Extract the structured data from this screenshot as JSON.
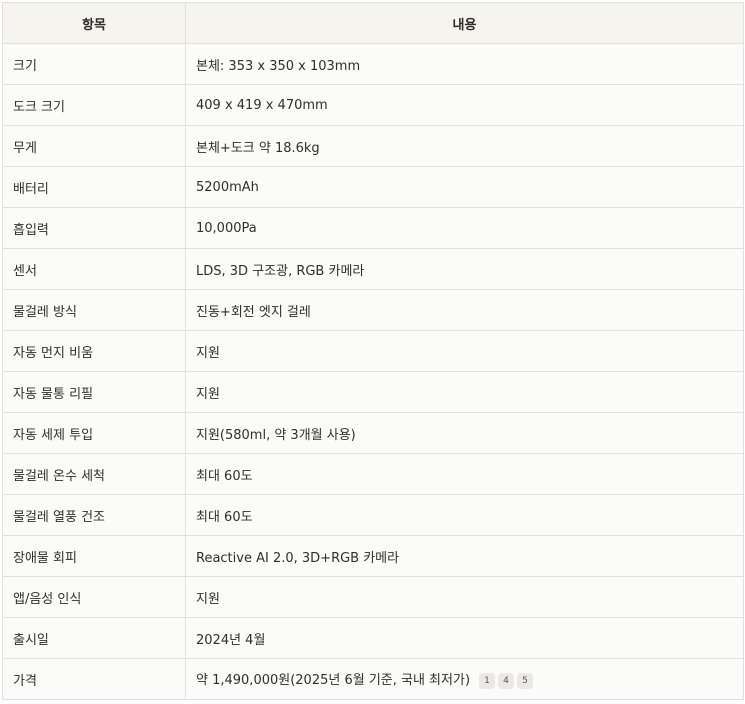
{
  "table": {
    "headers": [
      "항목",
      "내용"
    ],
    "rows": [
      {
        "label": "크기",
        "value": "본체: 353 x 350 x 103mm"
      },
      {
        "label": "도크 크기",
        "value": "409 x 419 x 470mm"
      },
      {
        "label": "무게",
        "value": "본체+도크 약 18.6kg"
      },
      {
        "label": "배터리",
        "value": "5200mAh"
      },
      {
        "label": "흡입력",
        "value": "10,000Pa"
      },
      {
        "label": "센서",
        "value": "LDS, 3D 구조광, RGB 카메라"
      },
      {
        "label": "물걸레 방식",
        "value": "진동+회전 엣지 걸레"
      },
      {
        "label": "자동 먼지 비움",
        "value": "지원"
      },
      {
        "label": "자동 물통 리필",
        "value": "지원"
      },
      {
        "label": "자동 세제 투입",
        "value": "지원(580ml, 약 3개월 사용)"
      },
      {
        "label": "물걸레 온수 세척",
        "value": "최대 60도"
      },
      {
        "label": "물걸레 열풍 건조",
        "value": "최대 60도"
      },
      {
        "label": "장애물 회피",
        "value": "Reactive AI 2.0, 3D+RGB 카메라"
      },
      {
        "label": "앱/음성 인식",
        "value": "지원"
      },
      {
        "label": "출시일",
        "value": "2024년 4월"
      },
      {
        "label": "가격",
        "value": "약 1,490,000원(2025년 6월 기준, 국내 최저가)",
        "citations": [
          "1",
          "4",
          "5"
        ]
      }
    ]
  }
}
